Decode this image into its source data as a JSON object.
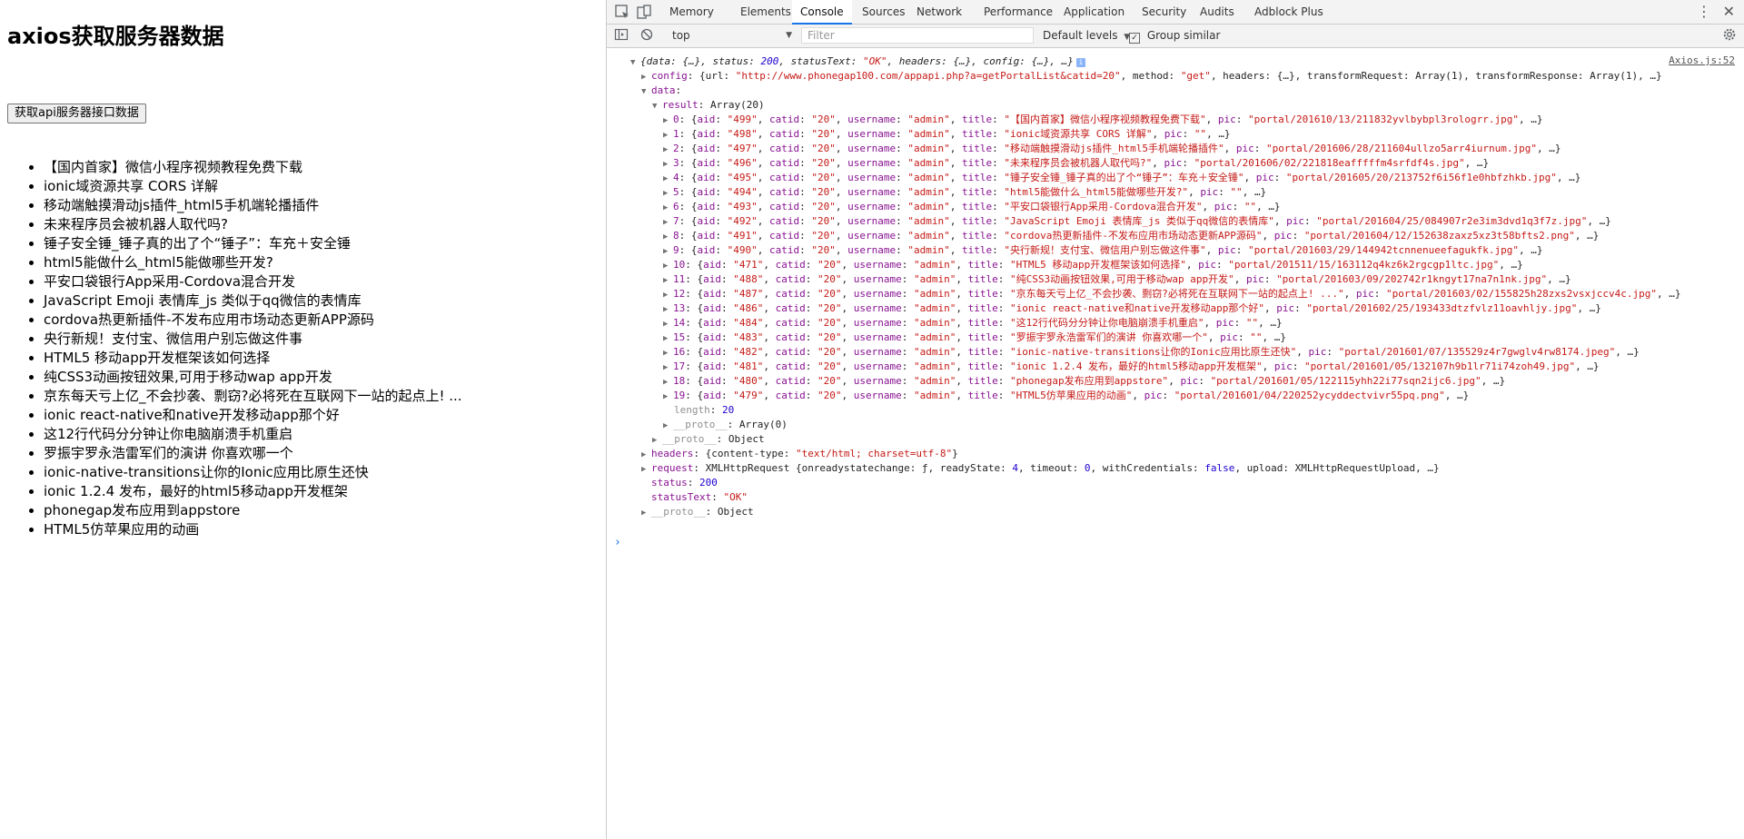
{
  "page": {
    "heading": "axios获取服务器数据",
    "button_label": "获取api服务器接口数据",
    "items": [
      "【国内首家】微信小程序视频教程免费下载",
      "ionic域资源共享 CORS 详解",
      "移动端触摸滑动js插件_html5手机端轮播插件",
      "未来程序员会被机器人取代吗?",
      "锤子安全锤_锤子真的出了个“锤子”：车充＋安全锤",
      "html5能做什么_html5能做哪些开发?",
      "平安口袋银行App采用-Cordova混合开发",
      "JavaScript Emoji 表情库_js 类似于qq微信的表情库",
      "cordova热更新插件-不发布应用市场动态更新APP源码",
      "央行新规！支付宝、微信用户别忘做这件事",
      "HTML5 移动app开发框架该如何选择",
      "纯CSS3动画按钮效果,可用于移动wap app开发",
      "京东每天亏上亿_不会抄袭、剽窃?必将死在互联网下一站的起点上! ...",
      "ionic react-native和native开发移动app那个好",
      "这12行代码分分钟让你电脑崩溃手机重启",
      "罗振宇罗永浩雷军们的演讲 你喜欢哪一个",
      "ionic-native-transitions让你的Ionic应用比原生还快",
      "ionic 1.2.4 发布，最好的html5移动app开发框架",
      "phonegap发布应用到appstore",
      "HTML5仿苹果应用的动画"
    ]
  },
  "devtools": {
    "tabs": [
      "Memory",
      "Elements",
      "Console",
      "Sources",
      "Network",
      "Performance",
      "Application",
      "Security",
      "Audits",
      "Adblock Plus"
    ],
    "active_tab": "Console",
    "context": "top",
    "filter_placeholder": "Filter",
    "levels": "Default levels",
    "group_similar": "Group similar",
    "source_link": "Axios.js:52",
    "lines": {
      "summary_a": "{data: {…}, status: ",
      "summary_status": "200",
      "summary_b": ", statusText: ",
      "summary_statustext": "\"OK\"",
      "summary_c": ", headers: {…}, config: {…}, …}",
      "config_key": "config",
      "config_a": ": {url: ",
      "config_url": "\"http://www.phonegap100.com/appapi.php?a=getPortalList&catid=20\"",
      "config_b": ", method: ",
      "config_method": "\"get\"",
      "config_c": ", headers: {…}, transformRequest: Array(1), transformResponse: Array(1), …}",
      "data_key": "data",
      "data_val": ":",
      "result_key": "result",
      "result_val": ": Array(20)",
      "length_key": "length",
      "length_val": "20",
      "proto_key": "__proto__",
      "proto_array": ": Array(0)",
      "proto_object": ": Object",
      "headers_key": "headers",
      "headers_a": ": {content-type: ",
      "headers_ct": "\"text/html; charset=utf-8\"",
      "headers_b": "}",
      "request_key": "request",
      "request_a": ": XMLHttpRequest {onreadystatechange: ƒ, readyState: ",
      "request_rs": "4",
      "request_b": ", timeout: ",
      "request_to": "0",
      "request_c": ", withCredentials: ",
      "request_wc": "false",
      "request_d": ", upload: XMLHttpRequestUpload, …}",
      "status_key": "status",
      "status_val": "200",
      "statustext_key": "statusText",
      "statustext_val": "\"OK\"",
      "proto2_key": "__proto__",
      "proto2_val": ": Object"
    },
    "results": [
      {
        "idx": "0",
        "aid": "\"499\"",
        "title": "\"【国内首家】微信小程序视频教程免费下载\"",
        "pic": "\"portal/201610/13/211832yvlbybpl3rologrr.jpg\""
      },
      {
        "idx": "1",
        "aid": "\"498\"",
        "title": "\"ionic域资源共享 CORS 详解\"",
        "pic": "\"\""
      },
      {
        "idx": "2",
        "aid": "\"497\"",
        "title": "\"移动端触摸滑动js插件_html5手机端轮播插件\"",
        "pic": "\"portal/201606/28/211604ullzo5arr4iurnum.jpg\""
      },
      {
        "idx": "3",
        "aid": "\"496\"",
        "title": "\"未来程序员会被机器人取代吗?\"",
        "pic": "\"portal/201606/02/221818eafffffm4srfdf4s.jpg\""
      },
      {
        "idx": "4",
        "aid": "\"495\"",
        "title": "\"锤子安全锤_锤子真的出了个“锤子”：车充＋安全锤\"",
        "pic": "\"portal/201605/20/213752f6i56f1e0hbfzhkb.jpg\""
      },
      {
        "idx": "5",
        "aid": "\"494\"",
        "title": "\"html5能做什么_html5能做哪些开发?\"",
        "pic": "\"\""
      },
      {
        "idx": "6",
        "aid": "\"493\"",
        "title": "\"平安口袋银行App采用-Cordova混合开发\"",
        "pic": "\"\""
      },
      {
        "idx": "7",
        "aid": "\"492\"",
        "title": "\"JavaScript Emoji 表情库_js 类似于qq微信的表情库\"",
        "pic": "\"portal/201604/25/084907r2e3im3dvd1q3f7z.jpg\""
      },
      {
        "idx": "8",
        "aid": "\"491\"",
        "title": "\"cordova热更新插件-不发布应用市场动态更新APP源码\"",
        "pic": "\"portal/201604/12/152638zaxz5xz3t58bfts2.png\""
      },
      {
        "idx": "9",
        "aid": "\"490\"",
        "title": "\"央行新规！支付宝、微信用户别忘做这件事\"",
        "pic": "\"portal/201603/29/144942tcnnenueefagukfk.jpg\""
      },
      {
        "idx": "10",
        "aid": "\"471\"",
        "title": "\"HTML5 移动app开发框架该如何选择\"",
        "pic": "\"portal/201511/15/163112q4kz6k2rgcgp1ltc.jpg\""
      },
      {
        "idx": "11",
        "aid": "\"488\"",
        "title": "\"纯CSS3动画按钮效果,可用于移动wap app开发\"",
        "pic": "\"portal/201603/09/202742r1kngyt17na7n1nk.jpg\""
      },
      {
        "idx": "12",
        "aid": "\"487\"",
        "title": "\"京东每天亏上亿_不会抄袭、剽窃?必将死在互联网下一站的起点上! ...\"",
        "pic": "\"portal/201603/02/155825h28zxs2vsxjccv4c.jpg\""
      },
      {
        "idx": "13",
        "aid": "\"486\"",
        "title": "\"ionic react-native和native开发移动app那个好\"",
        "pic": "\"portal/201602/25/193433dtzfvlz11oavhljy.jpg\""
      },
      {
        "idx": "14",
        "aid": "\"484\"",
        "title": "\"这12行代码分分钟让你电脑崩溃手机重启\"",
        "pic": "\"\""
      },
      {
        "idx": "15",
        "aid": "\"483\"",
        "title": "\"罗振宇罗永浩雷军们的演讲 你喜欢哪一个\"",
        "pic": "\"\""
      },
      {
        "idx": "16",
        "aid": "\"482\"",
        "title": "\"ionic-native-transitions让你的Ionic应用比原生还快\"",
        "pic": "\"portal/201601/07/135529z4r7gwglv4rw8174.jpeg\""
      },
      {
        "idx": "17",
        "aid": "\"481\"",
        "title": "\"ionic 1.2.4 发布，最好的html5移动app开发框架\"",
        "pic": "\"portal/201601/05/132107h9b1lr71i74zoh49.jpg\""
      },
      {
        "idx": "18",
        "aid": "\"480\"",
        "title": "\"phonegap发布应用到appstore\"",
        "pic": "\"portal/201601/05/122115yhh22i77sqn2ijc6.jpg\""
      },
      {
        "idx": "19",
        "aid": "\"479\"",
        "title": "\"HTML5仿苹果应用的动画\"",
        "pic": "\"portal/201601/04/220252ycyddectvivr55pq.png\""
      }
    ],
    "result_fields": {
      "catid_key": "catid",
      "catid_val": "\"20\"",
      "username_key": "username",
      "username_val": "\"admin\"",
      "aid_key": "aid",
      "title_key": "title",
      "pic_key": "pic",
      "tail": "…}"
    }
  }
}
